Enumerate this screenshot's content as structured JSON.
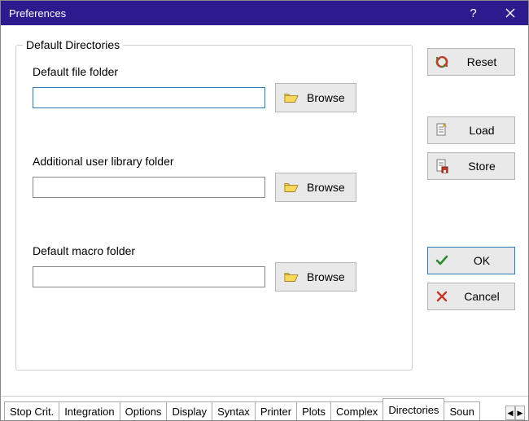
{
  "window": {
    "title": "Preferences"
  },
  "groupbox": {
    "legend": "Default Directories"
  },
  "fields": {
    "fileFolder": {
      "label": "Default file folder",
      "value": "",
      "browse": "Browse"
    },
    "libFolder": {
      "label": "Additional user library folder",
      "value": "",
      "browse": "Browse"
    },
    "macroFolder": {
      "label": "Default macro folder",
      "value": "",
      "browse": "Browse"
    }
  },
  "buttons": {
    "reset": "Reset",
    "load": "Load",
    "store": "Store",
    "ok": "OK",
    "cancel": "Cancel"
  },
  "tabs": {
    "items": [
      "Stop Crit.",
      "Integration",
      "Options",
      "Display",
      "Syntax",
      "Printer",
      "Plots",
      "Complex",
      "Directories",
      "Soun"
    ],
    "activeIndex": 8
  }
}
